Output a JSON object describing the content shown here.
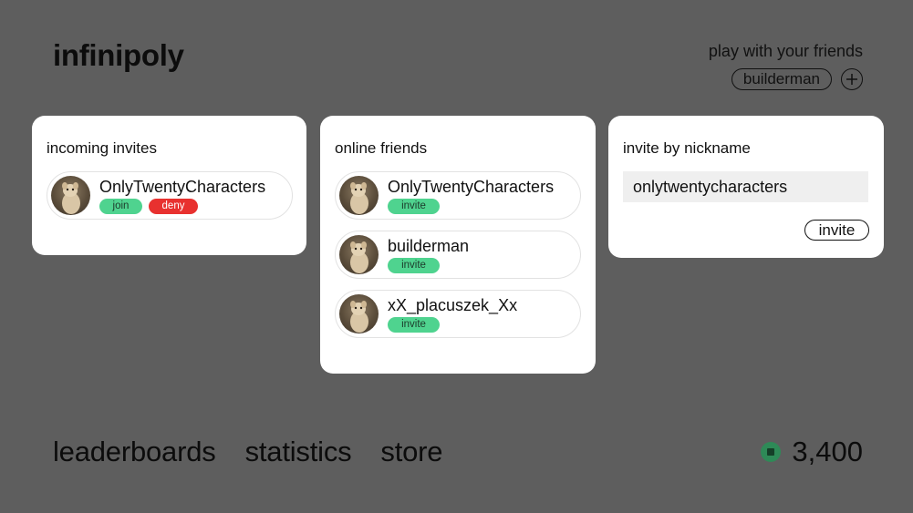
{
  "app": {
    "title": "infinipoly"
  },
  "party": {
    "caption": "play with your friends",
    "members": [
      "builderman"
    ],
    "add_icon": "plus-circle-icon"
  },
  "incoming": {
    "title": "incoming invites",
    "items": [
      {
        "name": "OnlyTwentyCharacters",
        "join_label": "join",
        "deny_label": "deny"
      }
    ]
  },
  "online": {
    "title": "online friends",
    "items": [
      {
        "name": "OnlyTwentyCharacters",
        "action_label": "invite"
      },
      {
        "name": "builderman",
        "action_label": "invite"
      },
      {
        "name": "xX_placuszek_Xx",
        "action_label": "invite"
      }
    ]
  },
  "invite_by_nickname": {
    "title": "invite by nickname",
    "input_value": "onlytwentycharacters",
    "button_label": "invite"
  },
  "nav": {
    "items": [
      "leaderboards",
      "statistics",
      "store"
    ]
  },
  "balance": {
    "icon": "coin-icon",
    "value": "3,400"
  },
  "colors": {
    "background": "#5e5e5e",
    "card": "#ffffff",
    "accent_green": "#4fd38f",
    "deny_red": "#e8312f",
    "coin": "#2e8a57"
  }
}
